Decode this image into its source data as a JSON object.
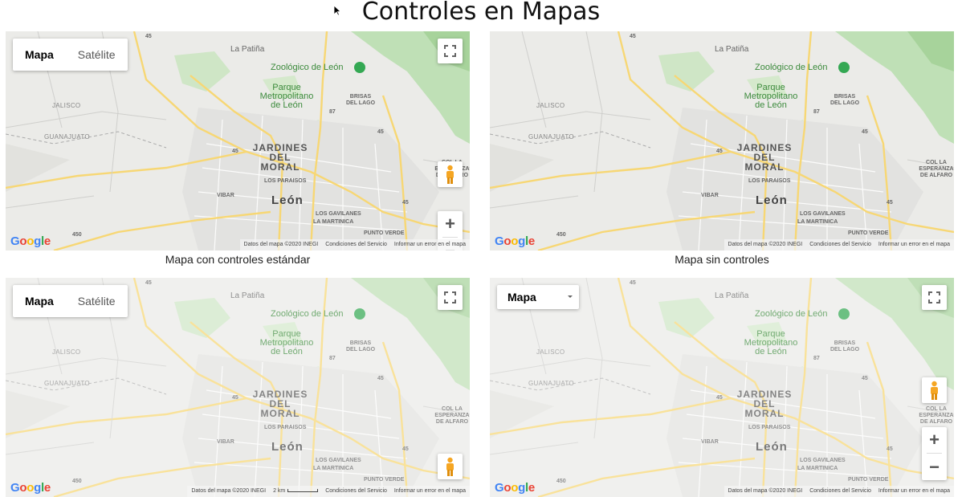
{
  "page": {
    "title": "Controles en Mapas"
  },
  "map_labels": {
    "highway_45": "45",
    "highway_87": "87",
    "highway_450": "450",
    "la_patina": "La Patiña",
    "zoo": "Zoológico de León",
    "parque": "Parque Metropolitano de León",
    "jalisco": "JALISCO",
    "guanajuato": "GUANAJUATO",
    "brisas": "BRISAS DEL LAGO",
    "jardines": "JARDINES DEL MORAL",
    "los_paraisos": "LOS PARAISOS",
    "col_la_esperanza": "COL LA ESPERANZA DE ALFARO",
    "vibar": "VIBAR",
    "leon": "León",
    "los_gavilanes": "LOS GAVILANES",
    "la_martinica": "LA MARTINICA",
    "punto_verde": "PUNTO VERDE"
  },
  "controls": {
    "map_type_map": "Mapa",
    "map_type_satellite": "Satélite",
    "dropdown_value": "Mapa",
    "zoom_in": "+",
    "zoom_out": "−"
  },
  "attribution": {
    "data": "Datos del mapa ©2020 INEGI",
    "scale": "2 km",
    "terms": "Condiciones del Servicio",
    "report": "Informar un error en el mapa"
  },
  "brand": {
    "g1": "G",
    "o1": "o",
    "o2": "o",
    "g2": "g",
    "l": "l",
    "e": "e"
  },
  "maps": [
    {
      "caption": "Mapa con controles estándar"
    },
    {
      "caption": "Mapa sin controles"
    },
    {
      "caption": ""
    },
    {
      "caption": ""
    }
  ],
  "colors": {
    "park_green": "#c8e4c0",
    "road_yellow": "#fbe08a",
    "google_blue": "#4285f4",
    "google_red": "#ea4335",
    "google_yellow": "#fbbc05",
    "google_green": "#34a853"
  }
}
